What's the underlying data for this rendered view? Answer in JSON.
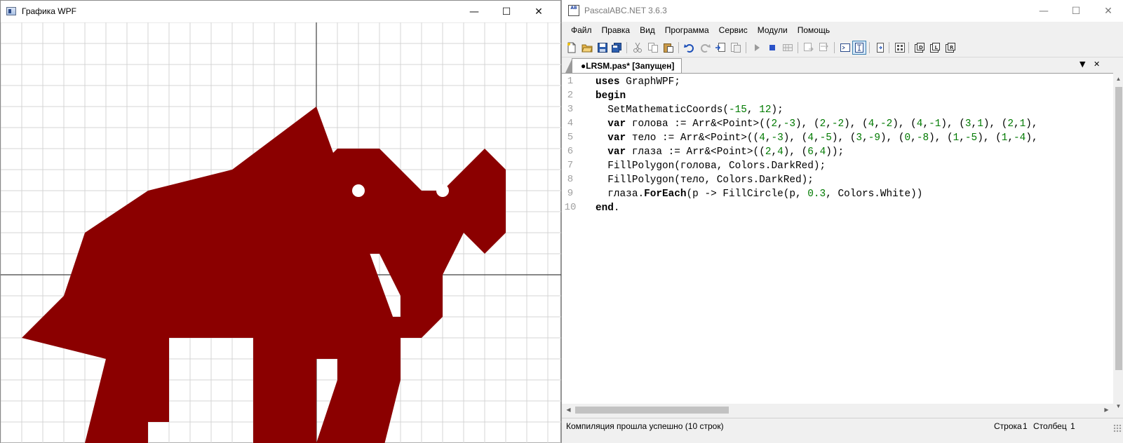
{
  "wpf_window": {
    "title": "Графика WPF",
    "controls": {
      "minimize": "—",
      "maximize": "☐",
      "close": "✕"
    }
  },
  "drawing": {
    "coord_system": {
      "origin": [
        -15,
        12
      ],
      "unit": 30
    },
    "grid_color": "#d4d4d4",
    "axis_color": "#404040",
    "fill_color": "#8b0000",
    "eye_color": "#ffffff",
    "head": [
      [
        2,
        -3
      ],
      [
        2,
        -2
      ],
      [
        4,
        -2
      ],
      [
        4,
        -1
      ],
      [
        3,
        1
      ],
      [
        2,
        1
      ],
      [
        1,
        0
      ],
      [
        0,
        0
      ],
      [
        -2,
        2
      ],
      [
        -2,
        4
      ],
      [
        0,
        4
      ],
      [
        0,
        5
      ],
      [
        1,
        6
      ],
      [
        3,
        6
      ],
      [
        5,
        4
      ],
      [
        6,
        4
      ],
      [
        8,
        6
      ],
      [
        9,
        5
      ],
      [
        9,
        3
      ],
      [
        9,
        2
      ],
      [
        8,
        1
      ],
      [
        7,
        2
      ],
      [
        6,
        0
      ],
      [
        6,
        -2
      ],
      [
        5,
        -3
      ]
    ],
    "body": [
      [
        4,
        -3
      ],
      [
        4,
        -5
      ],
      [
        3,
        -9
      ],
      [
        0,
        -8
      ],
      [
        1,
        -5
      ],
      [
        1,
        -4
      ],
      [
        0,
        -4
      ],
      [
        0,
        -9
      ],
      [
        -3,
        -9
      ],
      [
        -3,
        -3
      ],
      [
        -7,
        -3
      ],
      [
        -7,
        -7
      ],
      [
        -8,
        -7
      ],
      [
        -8,
        -8
      ],
      [
        -11,
        -8
      ],
      [
        -10,
        -4
      ],
      [
        -14,
        -3
      ],
      [
        -12,
        -1
      ],
      [
        -11,
        2
      ],
      [
        -8,
        4
      ],
      [
        -4,
        5
      ],
      [
        0,
        8
      ]
    ],
    "eyes": [
      [
        2,
        4
      ],
      [
        6,
        4
      ]
    ],
    "eye_radius": 0.3
  },
  "ide_window": {
    "title": "PascalABC.NET 3.6.3",
    "icon_text": "AB",
    "controls": {
      "minimize": "—",
      "maximize": "☐",
      "close": "✕"
    },
    "menu": [
      "Файл",
      "Правка",
      "Вид",
      "Программа",
      "Сервис",
      "Модули",
      "Помощь"
    ],
    "tab": {
      "label": "●LRSM.pas* [Запущен]",
      "dropdown": "▼",
      "close": "✕"
    },
    "code_lines": [
      {
        "no": "1",
        "parts": [
          [
            "kw",
            "uses"
          ],
          [
            "t",
            " GraphWPF;"
          ]
        ]
      },
      {
        "no": "2",
        "parts": [
          [
            "kw",
            "begin"
          ]
        ]
      },
      {
        "no": "3",
        "parts": [
          [
            "t",
            "  SetMathematicCoords("
          ],
          [
            "num",
            "-15"
          ],
          [
            "t",
            ", "
          ],
          [
            "num",
            "12"
          ],
          [
            "t",
            ");"
          ]
        ]
      },
      {
        "no": "4",
        "parts": [
          [
            "t",
            "  "
          ],
          [
            "kw",
            "var"
          ],
          [
            "t",
            " голова := Arr&<Point>(("
          ],
          [
            "num",
            "2"
          ],
          [
            "t",
            ","
          ],
          [
            "num",
            "-3"
          ],
          [
            "t",
            "), ("
          ],
          [
            "num",
            "2"
          ],
          [
            "t",
            ","
          ],
          [
            "num",
            "-2"
          ],
          [
            "t",
            "), ("
          ],
          [
            "num",
            "4"
          ],
          [
            "t",
            ","
          ],
          [
            "num",
            "-2"
          ],
          [
            "t",
            "), ("
          ],
          [
            "num",
            "4"
          ],
          [
            "t",
            ","
          ],
          [
            "num",
            "-1"
          ],
          [
            "t",
            "), ("
          ],
          [
            "num",
            "3"
          ],
          [
            "t",
            ","
          ],
          [
            "num",
            "1"
          ],
          [
            "t",
            "), ("
          ],
          [
            "num",
            "2"
          ],
          [
            "t",
            ","
          ],
          [
            "num",
            "1"
          ],
          [
            "t",
            "),"
          ]
        ]
      },
      {
        "no": "5",
        "parts": [
          [
            "t",
            "  "
          ],
          [
            "kw",
            "var"
          ],
          [
            "t",
            " тело := Arr&<Point>(("
          ],
          [
            "num",
            "4"
          ],
          [
            "t",
            ","
          ],
          [
            "num",
            "-3"
          ],
          [
            "t",
            "), ("
          ],
          [
            "num",
            "4"
          ],
          [
            "t",
            ","
          ],
          [
            "num",
            "-5"
          ],
          [
            "t",
            "), ("
          ],
          [
            "num",
            "3"
          ],
          [
            "t",
            ","
          ],
          [
            "num",
            "-9"
          ],
          [
            "t",
            "), ("
          ],
          [
            "num",
            "0"
          ],
          [
            "t",
            ","
          ],
          [
            "num",
            "-8"
          ],
          [
            "t",
            "), ("
          ],
          [
            "num",
            "1"
          ],
          [
            "t",
            ","
          ],
          [
            "num",
            "-5"
          ],
          [
            "t",
            "), ("
          ],
          [
            "num",
            "1"
          ],
          [
            "t",
            ","
          ],
          [
            "num",
            "-4"
          ],
          [
            "t",
            "),"
          ]
        ]
      },
      {
        "no": "6",
        "parts": [
          [
            "t",
            "  "
          ],
          [
            "kw",
            "var"
          ],
          [
            "t",
            " глаза := Arr&<Point>(("
          ],
          [
            "num",
            "2"
          ],
          [
            "t",
            ","
          ],
          [
            "num",
            "4"
          ],
          [
            "t",
            "), ("
          ],
          [
            "num",
            "6"
          ],
          [
            "t",
            ","
          ],
          [
            "num",
            "4"
          ],
          [
            "t",
            "));"
          ]
        ]
      },
      {
        "no": "7",
        "parts": [
          [
            "t",
            "  FillPolygon(голова, Colors.DarkRed);"
          ]
        ]
      },
      {
        "no": "8",
        "parts": [
          [
            "t",
            "  FillPolygon(тело, Colors.DarkRed);"
          ]
        ]
      },
      {
        "no": "9",
        "parts": [
          [
            "t",
            "  глаза."
          ],
          [
            "kw",
            "ForEach"
          ],
          [
            "t",
            "(p -> FillCircle(p, "
          ],
          [
            "num",
            "0.3"
          ],
          [
            "t",
            ", Colors.White))"
          ]
        ]
      },
      {
        "no": "10",
        "parts": [
          [
            "kw",
            "end"
          ],
          [
            "t",
            "."
          ]
        ]
      }
    ],
    "status": {
      "message": "Компиляция прошла успешно (10 строк)",
      "row_label": "Строка",
      "row_value": "1",
      "col_label": "Столбец",
      "col_value": "1"
    }
  }
}
